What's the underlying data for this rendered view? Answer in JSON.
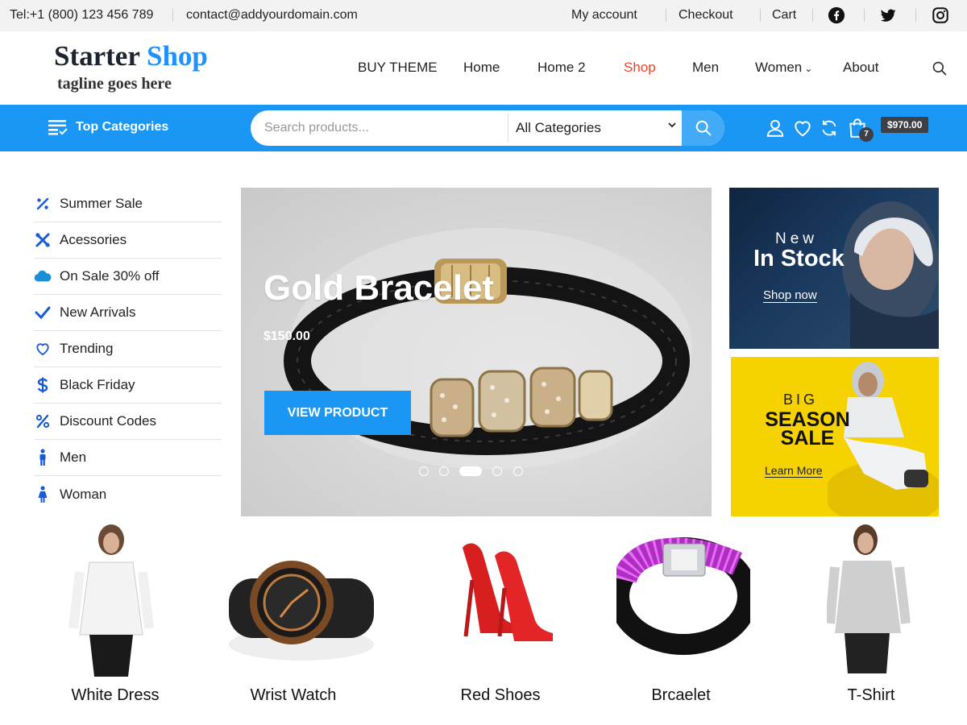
{
  "topbar": {
    "phone": "Tel:+1 (800) 123 456 789",
    "email": "contact@addyourdomain.com",
    "links": [
      "My account",
      "Checkout",
      "Cart"
    ],
    "social_icons": [
      "facebook-icon",
      "twitter-icon",
      "instagram-icon"
    ]
  },
  "header": {
    "logo_main": "Starter",
    "logo_accent": "Shop",
    "tagline": "tagline goes here",
    "nav": [
      "BUY THEME",
      "Home",
      "Home 2",
      "Shop",
      "Men",
      "Women",
      "About"
    ],
    "active_nav": "Shop",
    "dropdown_marker": "⌄"
  },
  "searchbar": {
    "top_categories_label": "Top Categories",
    "placeholder": "Search products...",
    "category_selected": "All Categories",
    "cart_count": "7",
    "cart_total": "$970.00"
  },
  "sidebar": {
    "items": [
      {
        "label": "Summer Sale",
        "icon": "percent-icon"
      },
      {
        "label": "Acessories",
        "icon": "tools-icon"
      },
      {
        "label": "On Sale 30% off",
        "icon": "cloud-icon"
      },
      {
        "label": "New Arrivals",
        "icon": "check-icon"
      },
      {
        "label": "Trending",
        "icon": "heart-icon"
      },
      {
        "label": "Black Friday",
        "icon": "dollar-icon"
      },
      {
        "label": "Discount Codes",
        "icon": "percent-icon"
      },
      {
        "label": "Men",
        "icon": "male-icon"
      },
      {
        "label": "Woman",
        "icon": "female-icon"
      }
    ]
  },
  "hero": {
    "title": "Gold Bracelet",
    "price": "$150.00",
    "button": "VIEW PRODUCT",
    "slide_count": 5,
    "active_slide": 3
  },
  "promos": {
    "promo1": {
      "line1": "New",
      "line2": "In Stock",
      "cta": "Shop now"
    },
    "promo2": {
      "line1": "BIG",
      "line2": "SEASON SALE",
      "cta": "Learn More"
    }
  },
  "products": [
    {
      "name": "White Dress"
    },
    {
      "name": "Wrist Watch"
    },
    {
      "name": "Red Shoes"
    },
    {
      "name": "Brcaelet"
    },
    {
      "name": "T-Shirt"
    }
  ],
  "colors": {
    "accent": "#1a96f5",
    "active_nav": "#e8452c",
    "promo_yellow": "#f5d200"
  }
}
